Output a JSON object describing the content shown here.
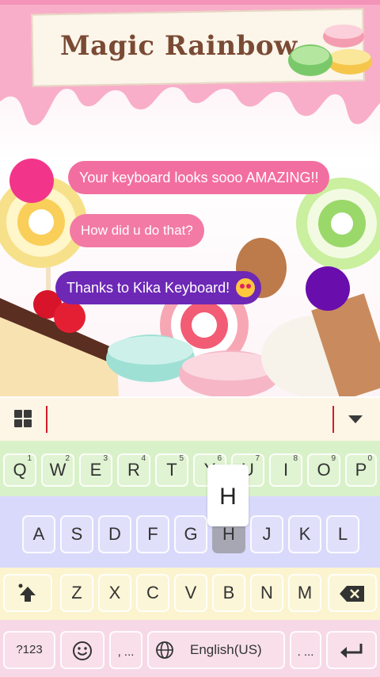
{
  "banner": {
    "title": "Magic Rainbow"
  },
  "chat": {
    "msg1": "Your keyboard looks sooo AMAZING!!",
    "msg2": "How did u do that?",
    "msg3": "Thanks to Kika Keyboard!"
  },
  "keyboard": {
    "row1": [
      {
        "label": "Q",
        "hint": "1"
      },
      {
        "label": "W",
        "hint": "2"
      },
      {
        "label": "E",
        "hint": "3"
      },
      {
        "label": "R",
        "hint": "4"
      },
      {
        "label": "T",
        "hint": "5"
      },
      {
        "label": "Y",
        "hint": "6"
      },
      {
        "label": "U",
        "hint": "7"
      },
      {
        "label": "I",
        "hint": "8"
      },
      {
        "label": "O",
        "hint": "9"
      },
      {
        "label": "P",
        "hint": "0"
      }
    ],
    "row2": [
      "A",
      "S",
      "D",
      "F",
      "G",
      "H",
      "J",
      "K",
      "L"
    ],
    "row3": [
      "Z",
      "X",
      "C",
      "V",
      "B",
      "N",
      "M"
    ],
    "popup": "H",
    "symbols_label": "?123",
    "comma_label": ", ...",
    "space_label": "English(US)",
    "period_label": ". ..."
  },
  "colors": {
    "accent_pink": "#f36ea0",
    "accent_purple": "#6d28b6",
    "cursor_red": "#d21c2c"
  }
}
